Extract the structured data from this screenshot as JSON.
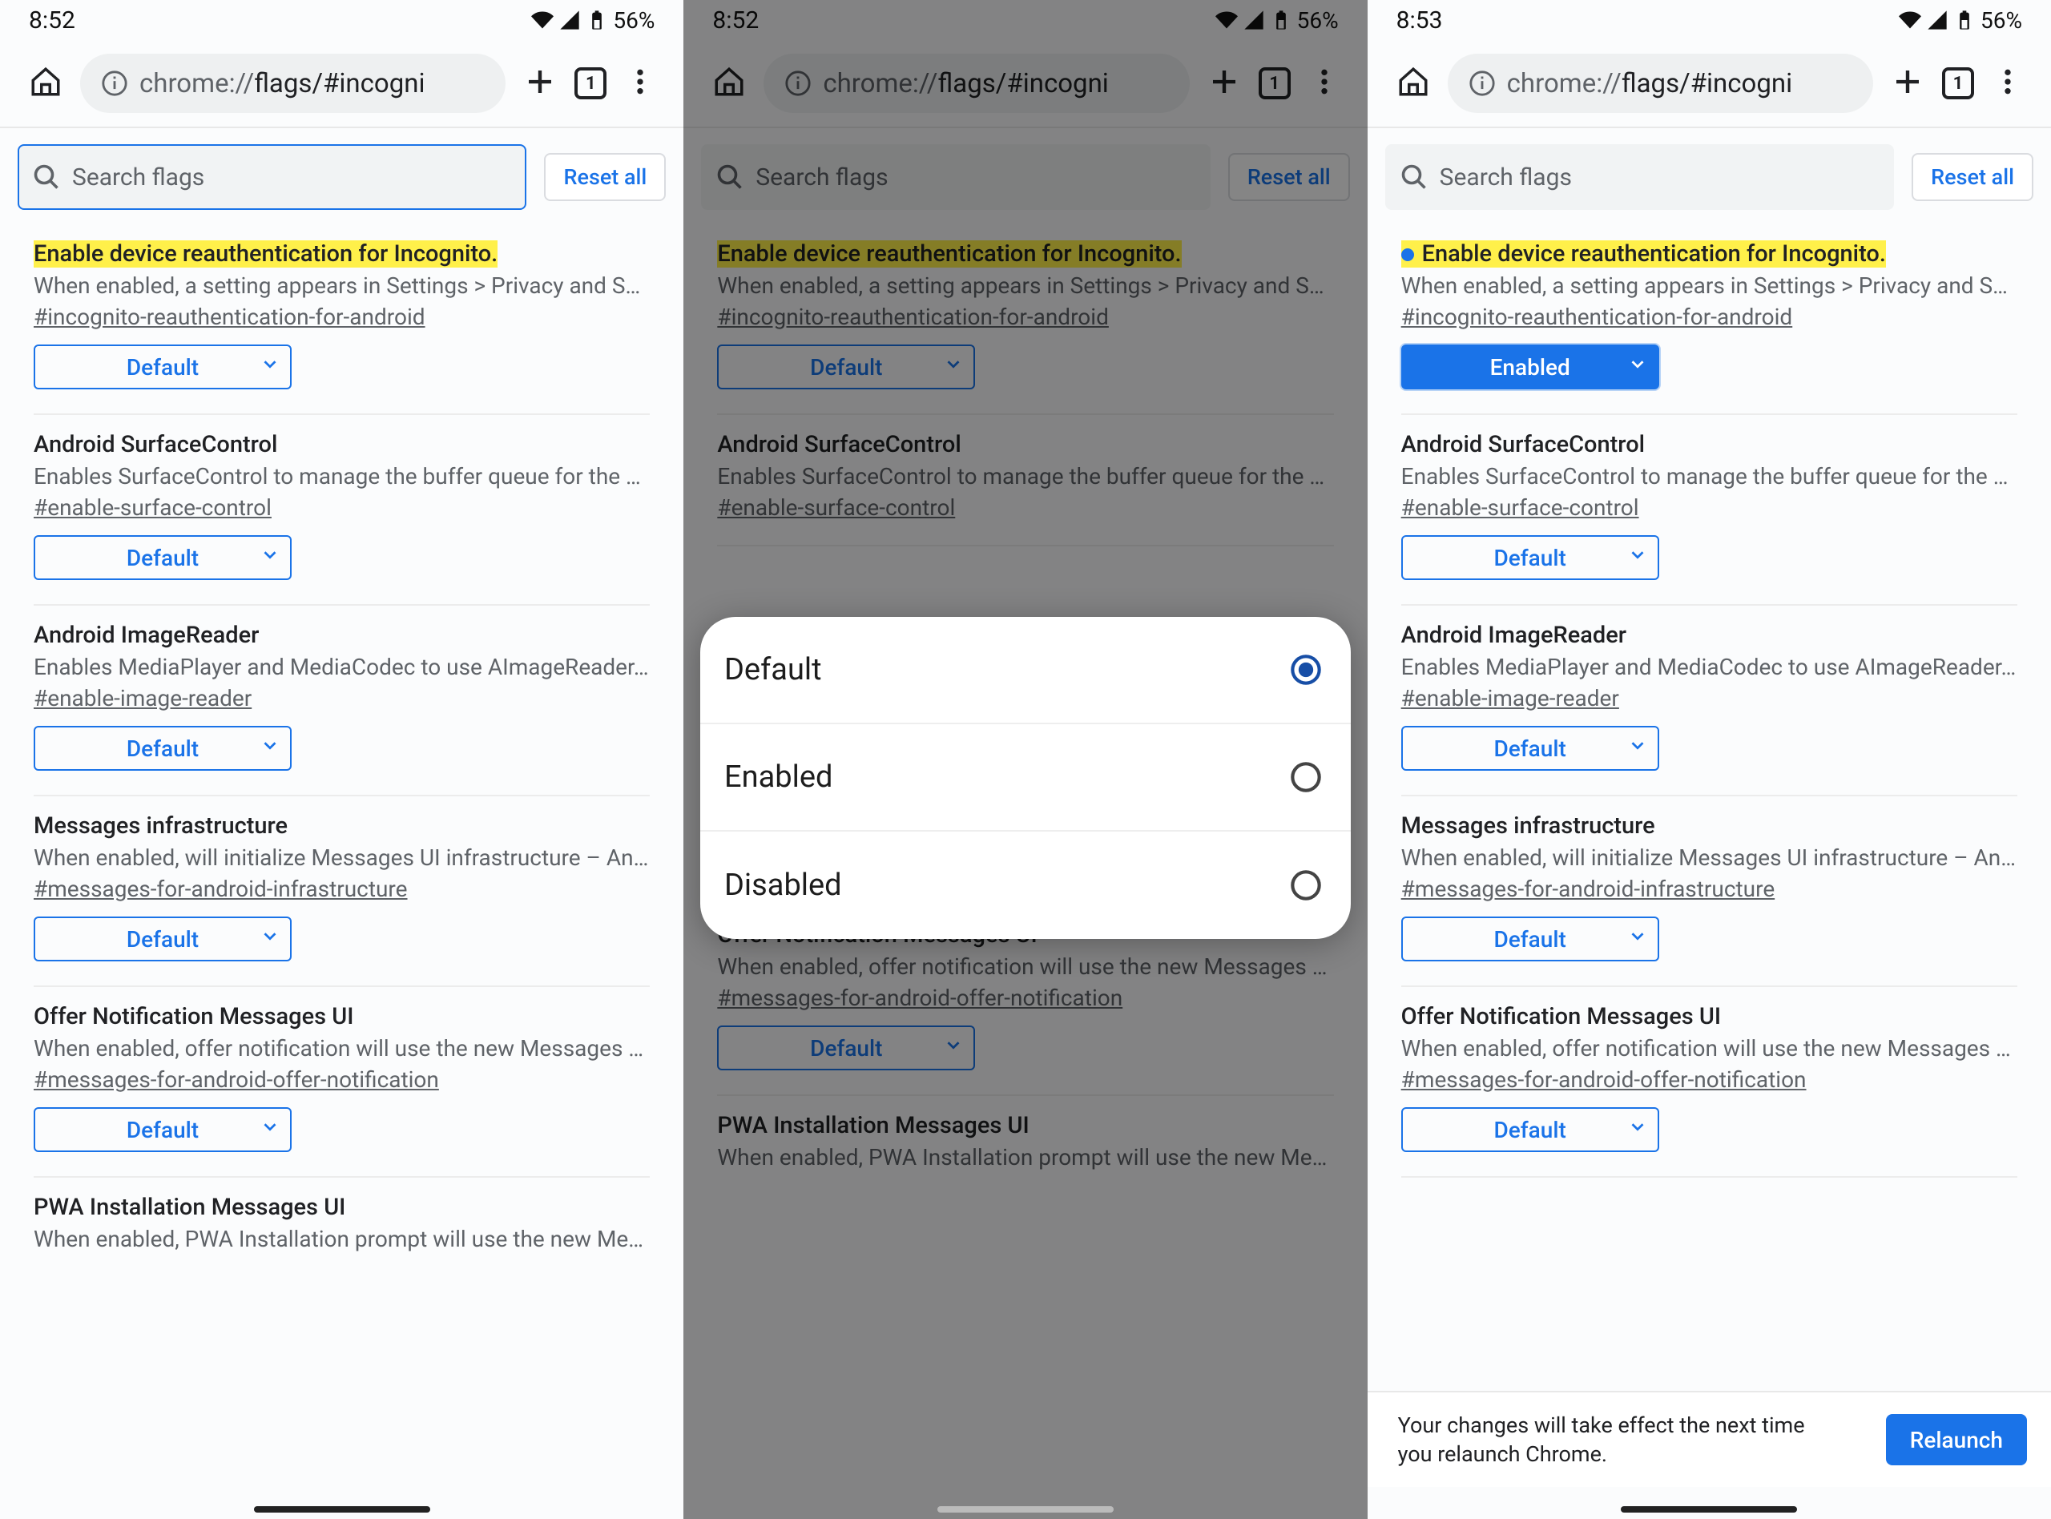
{
  "panels": [
    {
      "time": "8:52",
      "battery": "56%",
      "search_focused": true,
      "first_flag_enabled": false,
      "show_dialog": false,
      "show_relaunch": false
    },
    {
      "time": "8:52",
      "battery": "56%",
      "search_focused": false,
      "first_flag_enabled": false,
      "show_dialog": true,
      "show_relaunch": false
    },
    {
      "time": "8:53",
      "battery": "56%",
      "search_focused": false,
      "first_flag_enabled": true,
      "show_dialog": false,
      "show_relaunch": true
    }
  ],
  "url_prefix": "chrome://",
  "url_suffix": "flags/#incogni",
  "tab_count": "1",
  "search_placeholder": "Search flags",
  "reset_label": "Reset all",
  "select_default": "Default",
  "select_enabled": "Enabled",
  "dialog_options": [
    "Default",
    "Enabled",
    "Disabled"
  ],
  "relaunch_text": "Your changes will take effect the next time you relaunch Chrome.",
  "relaunch_button": "Relaunch",
  "flags": [
    {
      "title": "Enable device reauthentication for Incognito.",
      "highlight": true,
      "desc": "When enabled, a setting appears in Settings > Privacy and Se…",
      "anchor": "#incognito-reauthentication-for-android"
    },
    {
      "title": "Android SurfaceControl",
      "highlight": false,
      "desc": "Enables SurfaceControl to manage the buffer queue for the …",
      "anchor": "#enable-surface-control"
    },
    {
      "title": "Android ImageReader",
      "highlight": false,
      "desc": "Enables MediaPlayer and MediaCodec to use AImageReader…",
      "anchor": "#enable-image-reader"
    },
    {
      "title": "Messages infrastructure",
      "highlight": false,
      "desc": "When enabled, will initialize Messages UI infrastructure – An…",
      "anchor": "#messages-for-android-infrastructure"
    },
    {
      "title": "Offer Notification Messages UI",
      "highlight": false,
      "desc": "When enabled, offer notification will use the new Messages …",
      "anchor": "#messages-for-android-offer-notification"
    },
    {
      "title": "PWA Installation Messages UI",
      "highlight": false,
      "desc": "When enabled, PWA Installation prompt will use the new Mes…",
      "anchor": ""
    }
  ]
}
